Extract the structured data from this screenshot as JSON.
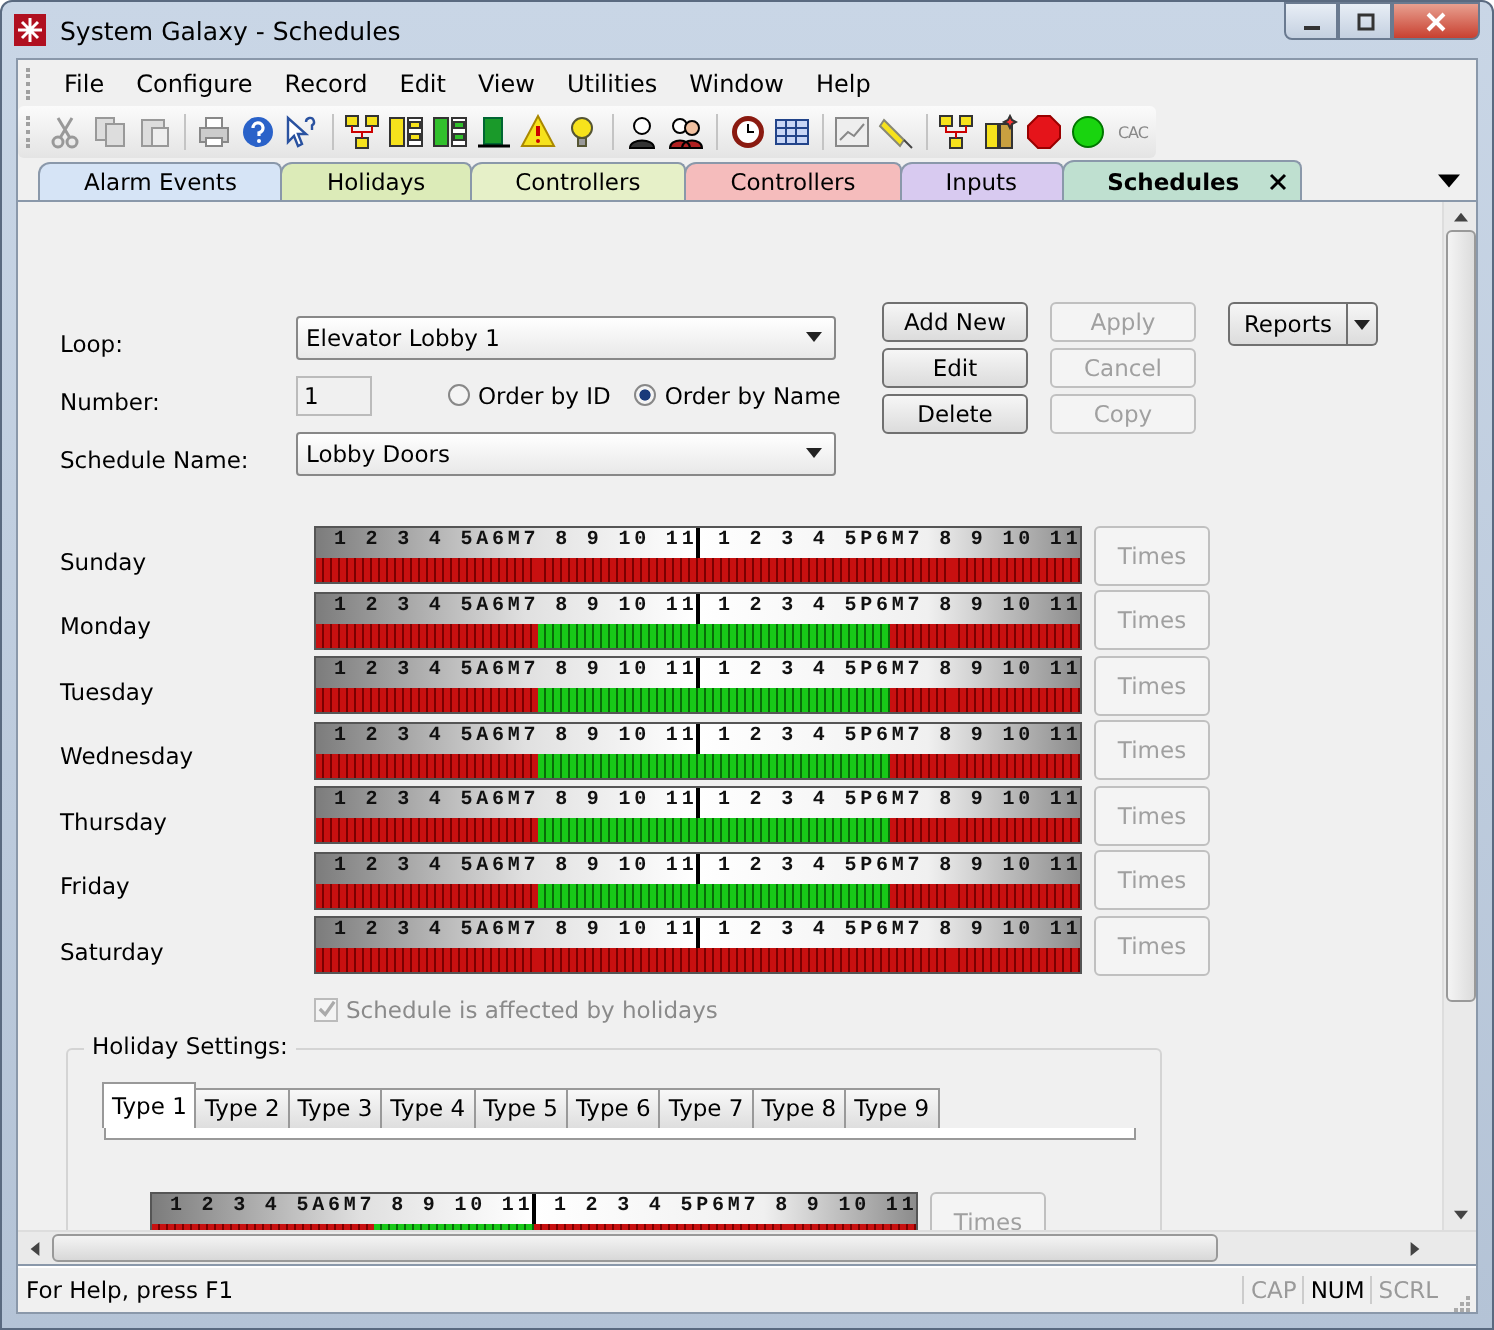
{
  "window": {
    "title": "System Galaxy - Schedules"
  },
  "menu": [
    "File",
    "Configure",
    "Record",
    "Edit",
    "View",
    "Utilities",
    "Window",
    "Help"
  ],
  "toolbar": {
    "text_icon": "CAC"
  },
  "doc_tabs": [
    {
      "label": "Alarm Events",
      "color": "#d6e4f6",
      "selected": false
    },
    {
      "label": "Holidays",
      "color": "#dcebb8",
      "selected": false
    },
    {
      "label": "Controllers",
      "color": "#e6f0c8",
      "selected": false
    },
    {
      "label": "Controllers",
      "color": "#f5bcbc",
      "selected": false
    },
    {
      "label": "Inputs",
      "color": "#d8caf0",
      "selected": false
    },
    {
      "label": "Schedules",
      "color": "#bfe0d0",
      "selected": true
    }
  ],
  "form": {
    "loop": {
      "label": "Loop:",
      "value": "Elevator Lobby 1"
    },
    "number": {
      "label": "Number:",
      "value": "1"
    },
    "order": [
      {
        "label": "Order by ID",
        "selected": false
      },
      {
        "label": "Order by Name",
        "selected": true
      }
    ],
    "schedule_name": {
      "label": "Schedule Name:",
      "value": "Lobby Doors"
    }
  },
  "buttons": [
    {
      "label": "Add New",
      "disabled": false
    },
    {
      "label": "Apply",
      "disabled": true
    },
    {
      "label": "Edit",
      "disabled": false
    },
    {
      "label": "Cancel",
      "disabled": true
    },
    {
      "label": "Delete",
      "disabled": false
    },
    {
      "label": "Copy",
      "disabled": true
    }
  ],
  "reports_button": {
    "label": "Reports"
  },
  "days": [
    {
      "day": "Sunday",
      "scale_am": "1 2 3 4 5A6M7 8 9 10 11",
      "scale_pm": "1 2 3 4 5P6M7 8 9 10 11",
      "times": {
        "label": "Times",
        "disabled": true
      },
      "hours": [
        {
          "on": false
        },
        {
          "on": false
        },
        {
          "on": false
        },
        {
          "on": false
        },
        {
          "on": false
        },
        {
          "on": false
        },
        {
          "on": false
        },
        {
          "on": false
        },
        {
          "on": false
        },
        {
          "on": false
        },
        {
          "on": false
        },
        {
          "on": false
        },
        {
          "on": false
        },
        {
          "on": false
        },
        {
          "on": false
        },
        {
          "on": false
        },
        {
          "on": false
        },
        {
          "on": false
        },
        {
          "on": false
        },
        {
          "on": false
        },
        {
          "on": false
        },
        {
          "on": false
        },
        {
          "on": false
        },
        {
          "on": false
        }
      ]
    },
    {
      "day": "Monday",
      "scale_am": "1 2 3 4 5A6M7 8 9 10 11",
      "scale_pm": "1 2 3 4 5P6M7 8 9 10 11",
      "times": {
        "label": "Times",
        "disabled": true
      },
      "hours": [
        {
          "on": false
        },
        {
          "on": false
        },
        {
          "on": false
        },
        {
          "on": false
        },
        {
          "on": false
        },
        {
          "on": false
        },
        {
          "on": false
        },
        {
          "on": true
        },
        {
          "on": true
        },
        {
          "on": true
        },
        {
          "on": true
        },
        {
          "on": true
        },
        {
          "on": true
        },
        {
          "on": true
        },
        {
          "on": true
        },
        {
          "on": true
        },
        {
          "on": true
        },
        {
          "on": true
        },
        {
          "on": false
        },
        {
          "on": false
        },
        {
          "on": false
        },
        {
          "on": false
        },
        {
          "on": false
        },
        {
          "on": false
        }
      ]
    },
    {
      "day": "Tuesday",
      "scale_am": "1 2 3 4 5A6M7 8 9 10 11",
      "scale_pm": "1 2 3 4 5P6M7 8 9 10 11",
      "times": {
        "label": "Times",
        "disabled": true
      },
      "hours": [
        {
          "on": false
        },
        {
          "on": false
        },
        {
          "on": false
        },
        {
          "on": false
        },
        {
          "on": false
        },
        {
          "on": false
        },
        {
          "on": false
        },
        {
          "on": true
        },
        {
          "on": true
        },
        {
          "on": true
        },
        {
          "on": true
        },
        {
          "on": true
        },
        {
          "on": true
        },
        {
          "on": true
        },
        {
          "on": true
        },
        {
          "on": true
        },
        {
          "on": true
        },
        {
          "on": true
        },
        {
          "on": false
        },
        {
          "on": false
        },
        {
          "on": false
        },
        {
          "on": false
        },
        {
          "on": false
        },
        {
          "on": false
        }
      ]
    },
    {
      "day": "Wednesday",
      "scale_am": "1 2 3 4 5A6M7 8 9 10 11",
      "scale_pm": "1 2 3 4 5P6M7 8 9 10 11",
      "times": {
        "label": "Times",
        "disabled": true
      },
      "hours": [
        {
          "on": false
        },
        {
          "on": false
        },
        {
          "on": false
        },
        {
          "on": false
        },
        {
          "on": false
        },
        {
          "on": false
        },
        {
          "on": false
        },
        {
          "on": true
        },
        {
          "on": true
        },
        {
          "on": true
        },
        {
          "on": true
        },
        {
          "on": true
        },
        {
          "on": true
        },
        {
          "on": true
        },
        {
          "on": true
        },
        {
          "on": true
        },
        {
          "on": true
        },
        {
          "on": true
        },
        {
          "on": false
        },
        {
          "on": false
        },
        {
          "on": false
        },
        {
          "on": false
        },
        {
          "on": false
        },
        {
          "on": false
        }
      ]
    },
    {
      "day": "Thursday",
      "scale_am": "1 2 3 4 5A6M7 8 9 10 11",
      "scale_pm": "1 2 3 4 5P6M7 8 9 10 11",
      "times": {
        "label": "Times",
        "disabled": true
      },
      "hours": [
        {
          "on": false
        },
        {
          "on": false
        },
        {
          "on": false
        },
        {
          "on": false
        },
        {
          "on": false
        },
        {
          "on": false
        },
        {
          "on": false
        },
        {
          "on": true
        },
        {
          "on": true
        },
        {
          "on": true
        },
        {
          "on": true
        },
        {
          "on": true
        },
        {
          "on": true
        },
        {
          "on": true
        },
        {
          "on": true
        },
        {
          "on": true
        },
        {
          "on": true
        },
        {
          "on": true
        },
        {
          "on": false
        },
        {
          "on": false
        },
        {
          "on": false
        },
        {
          "on": false
        },
        {
          "on": false
        },
        {
          "on": false
        }
      ]
    },
    {
      "day": "Friday",
      "scale_am": "1 2 3 4 5A6M7 8 9 10 11",
      "scale_pm": "1 2 3 4 5P6M7 8 9 10 11",
      "times": {
        "label": "Times",
        "disabled": true
      },
      "hours": [
        {
          "on": false
        },
        {
          "on": false
        },
        {
          "on": false
        },
        {
          "on": false
        },
        {
          "on": false
        },
        {
          "on": false
        },
        {
          "on": false
        },
        {
          "on": true
        },
        {
          "on": true
        },
        {
          "on": true
        },
        {
          "on": true
        },
        {
          "on": true
        },
        {
          "on": true
        },
        {
          "on": true
        },
        {
          "on": true
        },
        {
          "on": true
        },
        {
          "on": true
        },
        {
          "on": true
        },
        {
          "on": false
        },
        {
          "on": false
        },
        {
          "on": false
        },
        {
          "on": false
        },
        {
          "on": false
        },
        {
          "on": false
        }
      ]
    },
    {
      "day": "Saturday",
      "scale_am": "1 2 3 4 5A6M7 8 9 10 11",
      "scale_pm": "1 2 3 4 5P6M7 8 9 10 11",
      "times": {
        "label": "Times",
        "disabled": true
      },
      "hours": [
        {
          "on": false
        },
        {
          "on": false
        },
        {
          "on": false
        },
        {
          "on": false
        },
        {
          "on": false
        },
        {
          "on": false
        },
        {
          "on": false
        },
        {
          "on": false
        },
        {
          "on": false
        },
        {
          "on": false
        },
        {
          "on": false
        },
        {
          "on": false
        },
        {
          "on": false
        },
        {
          "on": false
        },
        {
          "on": false
        },
        {
          "on": false
        },
        {
          "on": false
        },
        {
          "on": false
        },
        {
          "on": false
        },
        {
          "on": false
        },
        {
          "on": false
        },
        {
          "on": false
        },
        {
          "on": false
        },
        {
          "on": false
        }
      ]
    }
  ],
  "holiday_checkbox": {
    "label": "Schedule is affected by holidays",
    "checked": true,
    "disabled": true
  },
  "holiday_settings": {
    "title": "Holiday Settings:",
    "types": [
      {
        "label": "Type 1",
        "selected": true
      },
      {
        "label": "Type 2",
        "selected": false
      },
      {
        "label": "Type 3",
        "selected": false
      },
      {
        "label": "Type 4",
        "selected": false
      },
      {
        "label": "Type 5",
        "selected": false
      },
      {
        "label": "Type 6",
        "selected": false
      },
      {
        "label": "Type 7",
        "selected": false
      },
      {
        "label": "Type 8",
        "selected": false
      },
      {
        "label": "Type 9",
        "selected": false
      }
    ],
    "bar": {
      "scale_am": "1 2 3 4 5A6M7 8 9 10 11",
      "scale_pm": "1 2 3 4 5P6M7 8 9 10 11",
      "hours": [
        {
          "on": false
        },
        {
          "on": false
        },
        {
          "on": false
        },
        {
          "on": false
        },
        {
          "on": false
        },
        {
          "on": false
        },
        {
          "on": false
        },
        {
          "on": true
        },
        {
          "on": true
        },
        {
          "on": true
        },
        {
          "on": true
        },
        {
          "on": true
        },
        {
          "on": false
        },
        {
          "on": false
        },
        {
          "on": false
        },
        {
          "on": false
        },
        {
          "on": false
        },
        {
          "on": false
        },
        {
          "on": false
        },
        {
          "on": false
        },
        {
          "on": false
        },
        {
          "on": false
        },
        {
          "on": false
        },
        {
          "on": false
        }
      ]
    },
    "times": {
      "label": "Times",
      "disabled": true
    }
  },
  "status_bar": {
    "text": "For Help, press F1",
    "indicators": [
      {
        "label": "CAP",
        "on": false
      },
      {
        "label": "NUM",
        "on": true
      },
      {
        "label": "SCRL",
        "on": false
      }
    ]
  }
}
